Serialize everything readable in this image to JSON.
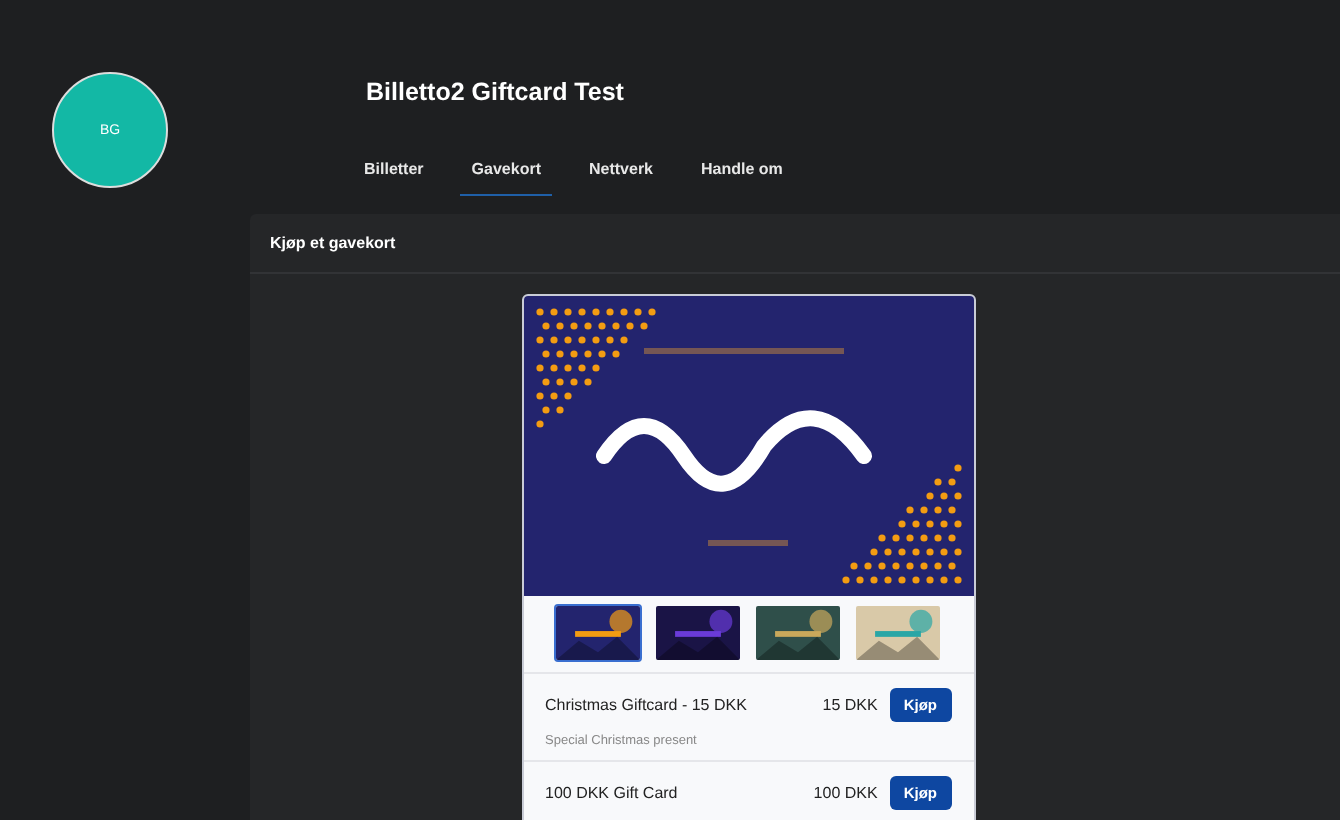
{
  "avatar": {
    "initials": "BG"
  },
  "title": "Billetto2 Giftcard Test",
  "tabs": [
    {
      "label": "Billetter",
      "selected": false
    },
    {
      "label": "Gavekort",
      "selected": true
    },
    {
      "label": "Nettverk",
      "selected": false
    },
    {
      "label": "Handle om",
      "selected": false
    }
  ],
  "panel": {
    "title": "Kjøp et gavekort",
    "banner": {
      "kind": "picture"
    },
    "thumbnails": [
      {
        "kind": "picture",
        "selected": true
      },
      {
        "kind": "picture",
        "selected": false
      },
      {
        "kind": "picture",
        "selected": false
      },
      {
        "kind": "picture",
        "selected": false
      }
    ],
    "giftcards": [
      {
        "name": "Christmas Giftcard - 15 DKK",
        "price": "15 DKK",
        "description": "Special Christmas present",
        "button": "Kjøp"
      },
      {
        "name": "100 DKK Gift Card",
        "price": "100 DKK",
        "button": "Kjøp"
      }
    ]
  }
}
